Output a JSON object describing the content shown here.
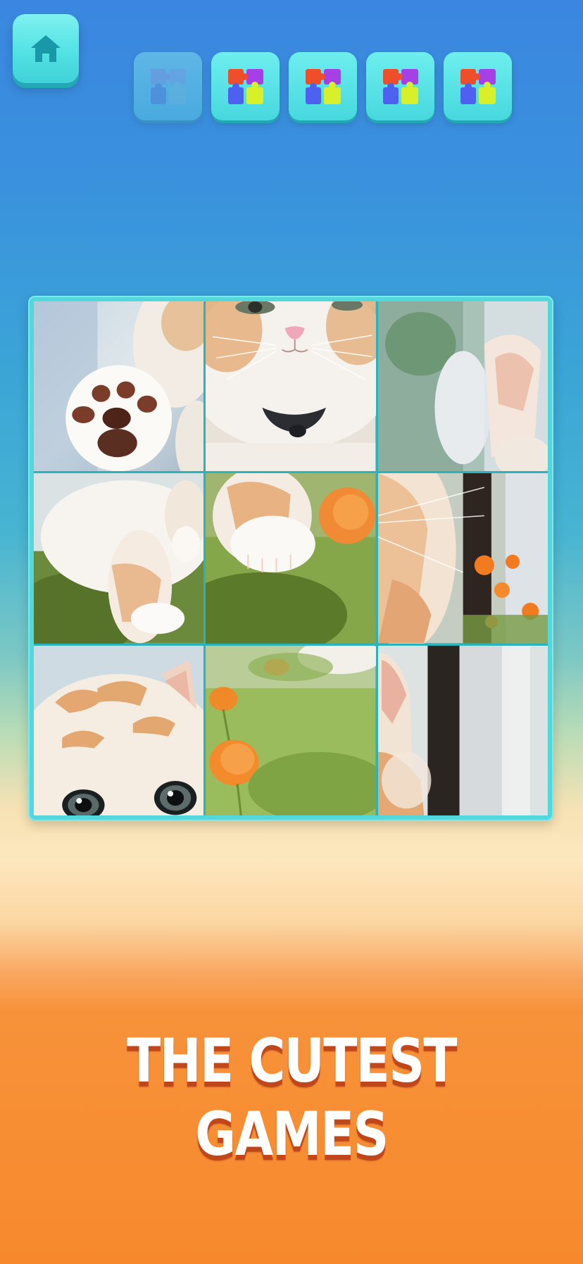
{
  "header": {
    "home_icon": "home-icon",
    "levels": [
      {
        "icon": "puzzle-icon",
        "state": "current"
      },
      {
        "icon": "puzzle-icon",
        "state": "available"
      },
      {
        "icon": "puzzle-icon",
        "state": "available"
      },
      {
        "icon": "puzzle-icon",
        "state": "available"
      },
      {
        "icon": "puzzle-icon",
        "state": "available"
      }
    ]
  },
  "board": {
    "rows": 3,
    "cols": 3,
    "tiles": [
      "kitten-paw-raised",
      "kitten-face-pink-nose",
      "blurred-ear-background",
      "kitten-leg-on-grass",
      "kitten-paw-grass-orange-flower",
      "kitten-whiskers-orange-flowers",
      "kitten-eyes-peeking",
      "grass-orange-flowers",
      "kitten-ear-tree-trunk"
    ]
  },
  "tagline": {
    "line1": "THE CUTEST",
    "line2": "GAMES"
  },
  "colors": {
    "accent": "#51d7dc",
    "button_top": "#7ff1f0",
    "button_shadow": "#23a8b6",
    "bg_top": "#3a86e0",
    "bg_bottom": "#f7892c",
    "tagline_shadow": "#c0461c"
  }
}
